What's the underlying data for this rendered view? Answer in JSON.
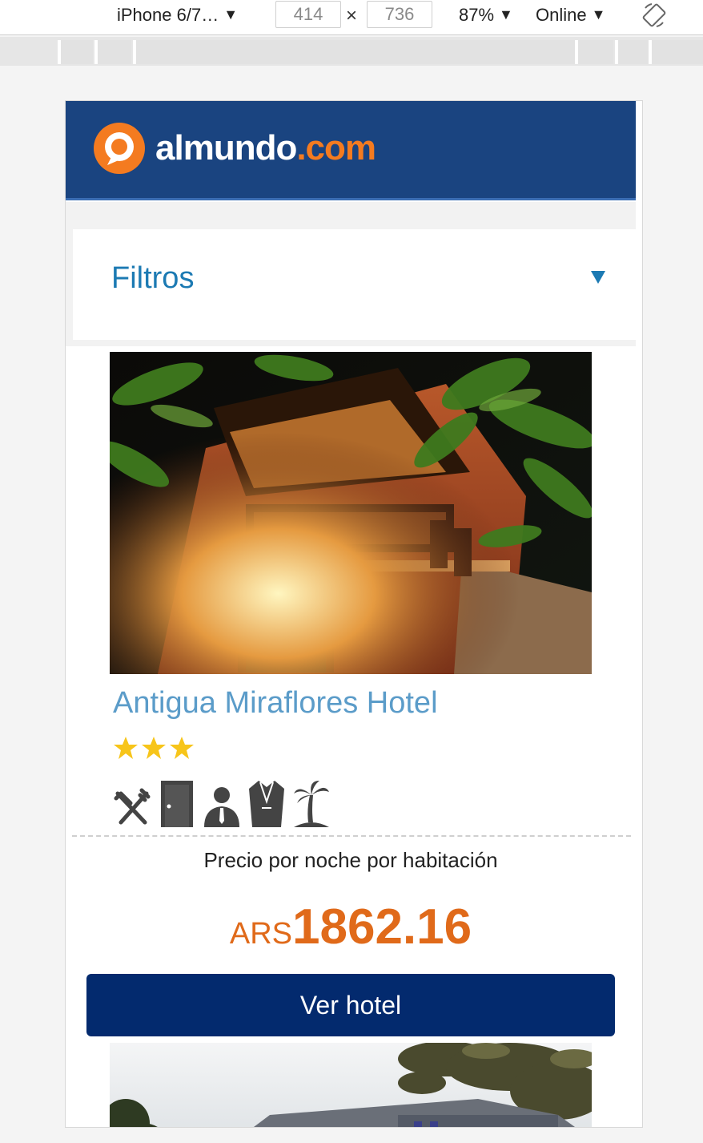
{
  "devtools": {
    "device": "iPhone 6/7…",
    "width": "414",
    "height": "736",
    "times": "×",
    "zoom": "87%",
    "network": "Online"
  },
  "site": {
    "logo_name": "almundo",
    "logo_tld": ".com",
    "brand_color": "#1a4480",
    "accent_color": "#f47b20"
  },
  "filters": {
    "title": "Filtros"
  },
  "hotel": {
    "name": "Antigua Miraflores Hotel",
    "stars": 3,
    "amenities": [
      "restaurant-icon",
      "room-door-icon",
      "concierge-icon",
      "bathrobe-icon",
      "beach-palm-icon"
    ],
    "price_caption": "Precio por noche por habitación",
    "price_currency": "ARS",
    "price_amount": "1862.16",
    "cta_label": "Ver hotel"
  }
}
